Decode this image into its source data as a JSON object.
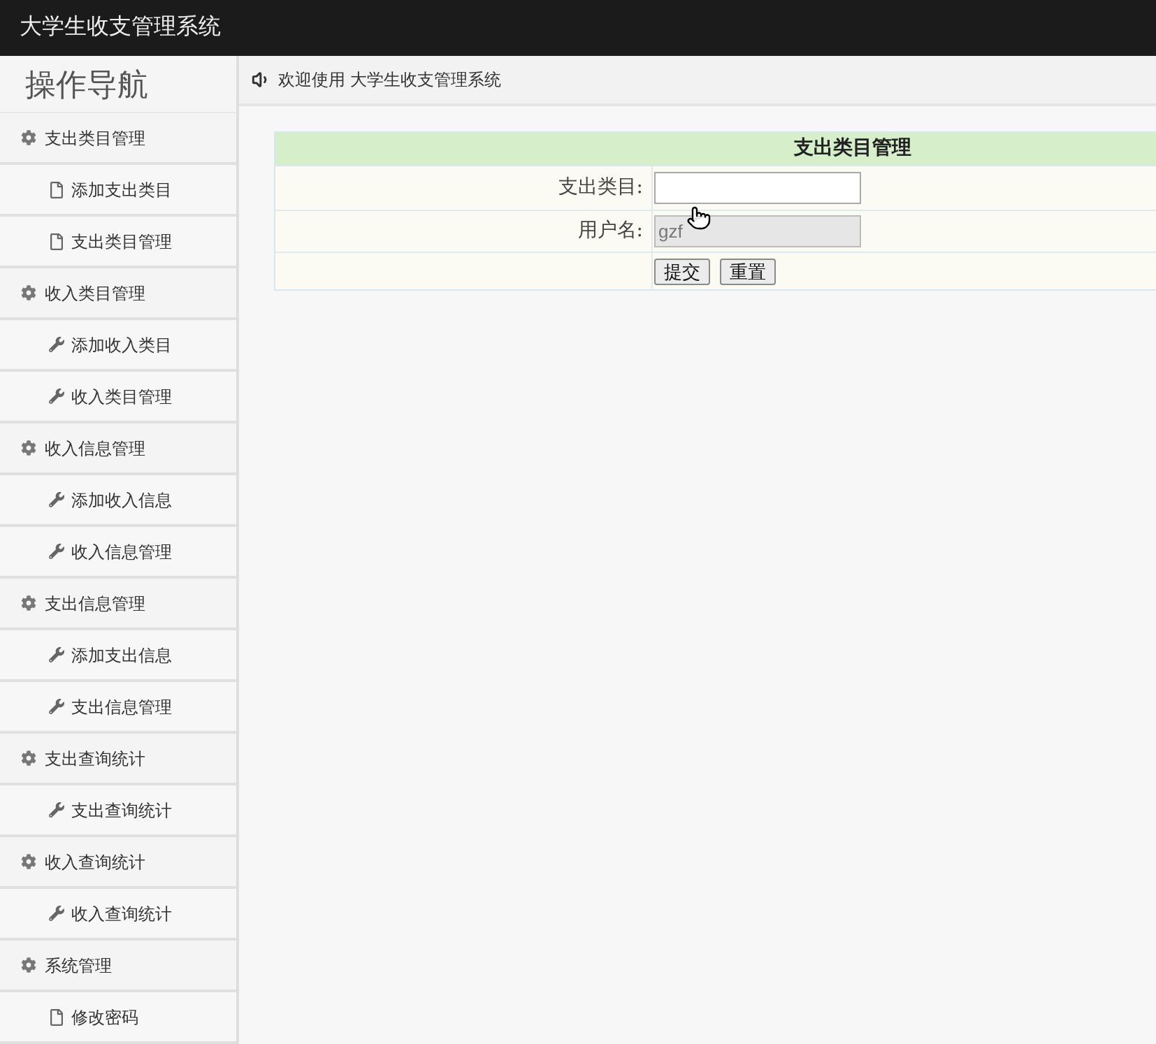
{
  "header": {
    "title": "大学生收支管理系统"
  },
  "sidebar": {
    "title": "操作导航",
    "groups": [
      {
        "label": "支出类目管理",
        "items": [
          {
            "label": "添加支出类目",
            "kind": "document"
          },
          {
            "label": "支出类目管理",
            "kind": "document"
          }
        ]
      },
      {
        "label": "收入类目管理",
        "items": [
          {
            "label": "添加收入类目",
            "kind": "tool"
          },
          {
            "label": "收入类目管理",
            "kind": "tool"
          }
        ]
      },
      {
        "label": "收入信息管理",
        "items": [
          {
            "label": "添加收入信息",
            "kind": "tool"
          },
          {
            "label": "收入信息管理",
            "kind": "tool"
          }
        ]
      },
      {
        "label": "支出信息管理",
        "items": [
          {
            "label": "添加支出信息",
            "kind": "tool"
          },
          {
            "label": "支出信息管理",
            "kind": "tool"
          }
        ]
      },
      {
        "label": "支出查询统计",
        "items": [
          {
            "label": "支出查询统计",
            "kind": "tool"
          }
        ]
      },
      {
        "label": "收入查询统计",
        "items": [
          {
            "label": "收入查询统计",
            "kind": "tool"
          }
        ]
      },
      {
        "label": "系统管理",
        "items": [
          {
            "label": "修改密码",
            "kind": "document"
          }
        ]
      }
    ]
  },
  "breadcrumb": {
    "text": "欢迎使用 大学生收支管理系统"
  },
  "form": {
    "title": "支出类目管理",
    "fields": [
      {
        "label": "支出类目:",
        "disabled": false
      },
      {
        "label": "用户名:",
        "value": "gzf",
        "disabled": true
      }
    ],
    "buttons": [
      "提交",
      "重置"
    ]
  }
}
